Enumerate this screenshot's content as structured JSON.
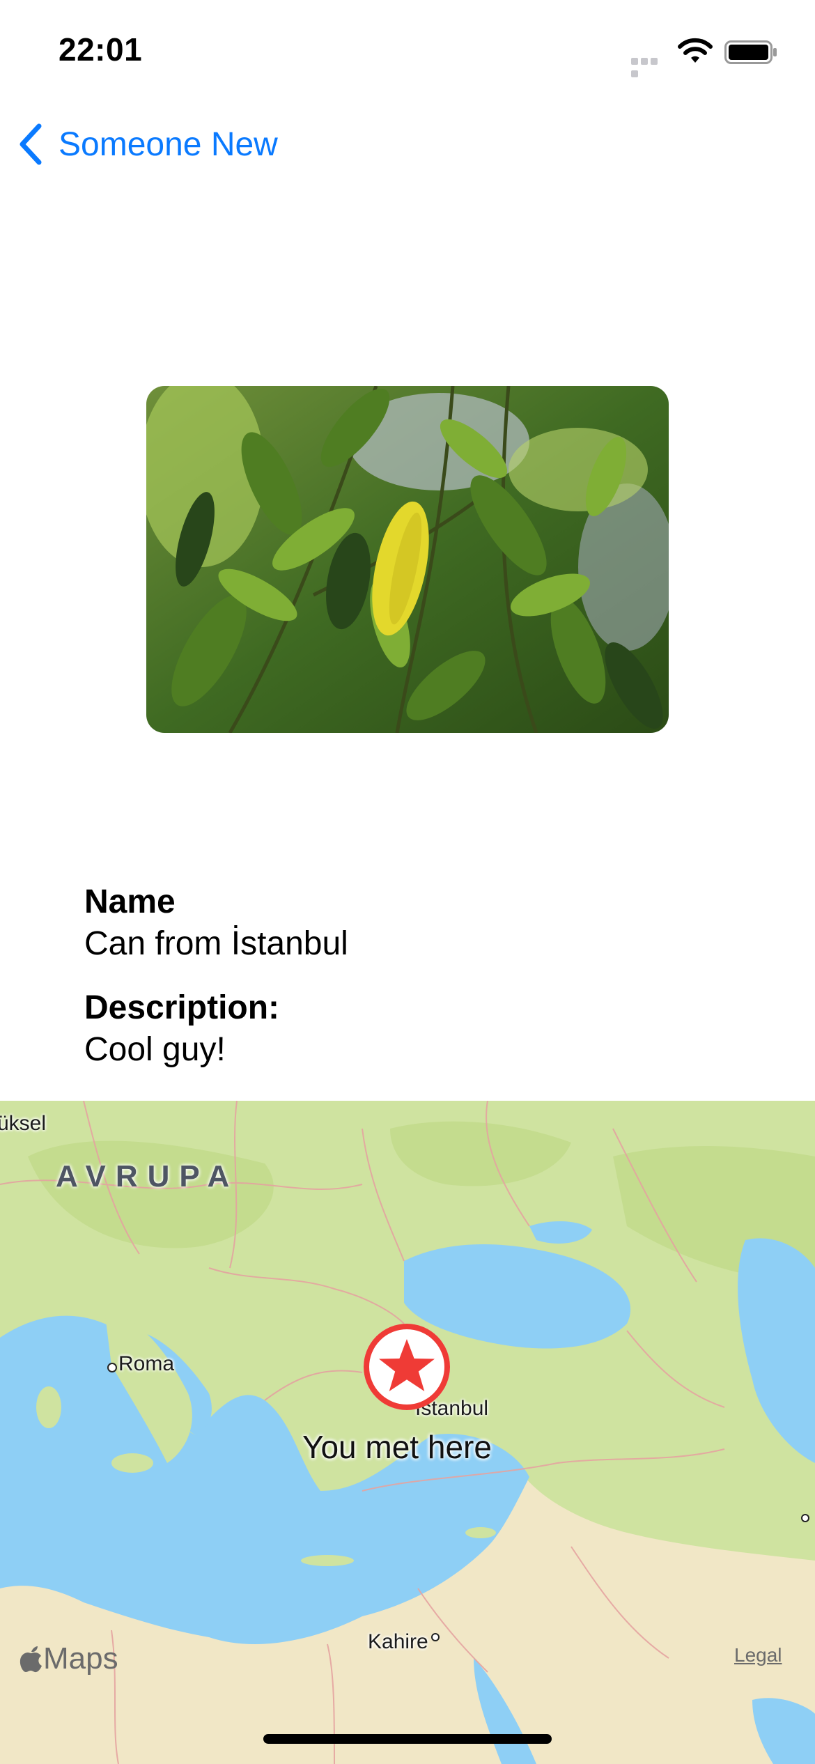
{
  "status_bar": {
    "time": "22:01"
  },
  "nav": {
    "back_label": "Someone New"
  },
  "details": {
    "name_label": "Name",
    "name_value": "Can from İstanbul",
    "description_label": "Description:",
    "description_value": "Cool guy!"
  },
  "map": {
    "region_label": "AVRUPA",
    "partial_city_label": "üksel",
    "cities": [
      "Roma",
      "İstanbul",
      "Kahire"
    ],
    "pin_caption": "You met here",
    "logo_text": "Maps",
    "legal_link": "Legal"
  },
  "colors": {
    "accent": "#0a7aff",
    "pin": "#ef3b36",
    "water": "#8ecff5",
    "land_green": "#cfe3a0",
    "land_sand": "#f1e7c6"
  }
}
